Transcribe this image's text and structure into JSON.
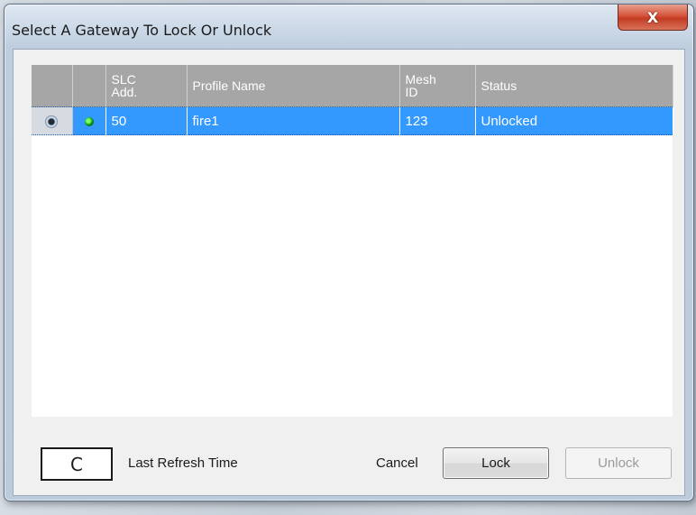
{
  "window": {
    "title": "Select A Gateway To Lock Or Unlock",
    "close_label": "X"
  },
  "grid": {
    "columns": [
      "",
      "",
      "SLC Add.",
      "Profile Name",
      "Mesh ID",
      "Status"
    ],
    "rows": [
      {
        "selected": true,
        "indicator": "green-dot",
        "slc_add": "50",
        "profile_name": "fire1",
        "mesh_id": "123",
        "status": "Unlocked"
      }
    ]
  },
  "footer": {
    "refresh_icon": "C",
    "last_refresh_label": "Last Refresh Time",
    "cancel_label": "Cancel",
    "lock_label": "Lock",
    "unlock_label": "Unlock"
  },
  "colors": {
    "selection": "#3399ff",
    "header": "#a6a6a6",
    "close": "#c23c22"
  }
}
